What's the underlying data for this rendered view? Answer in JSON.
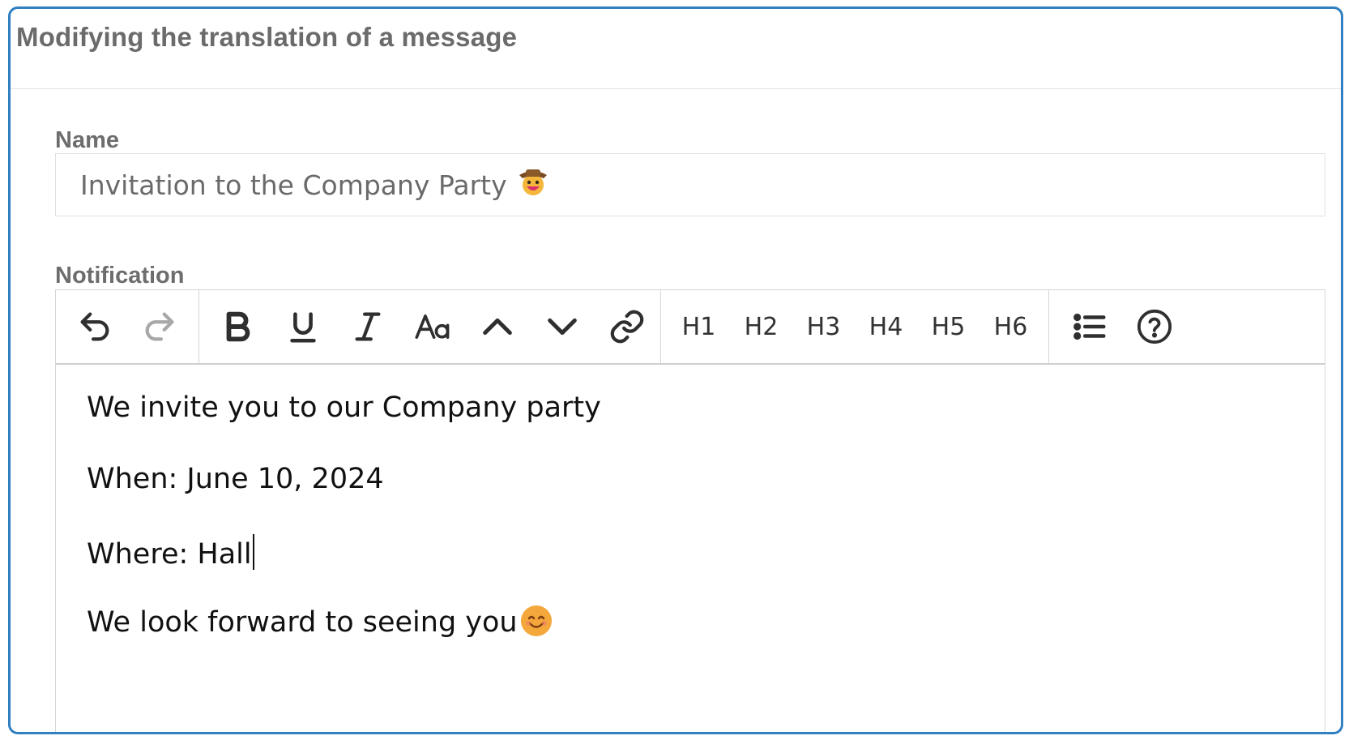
{
  "dialog": {
    "title": "Modifying the translation of a message"
  },
  "name_field": {
    "label": "Name",
    "value": "Invitation to the Company Party",
    "emoji": "🤠"
  },
  "notification": {
    "label": "Notification",
    "toolbar": {
      "history": [
        {
          "name": "undo-icon",
          "enabled": true
        },
        {
          "name": "redo-icon",
          "enabled": false
        }
      ],
      "format": [
        "bold-icon",
        "underline-icon",
        "italic-icon",
        "font-size-icon",
        "chevron-up-icon",
        "chevron-down-icon",
        "link-icon"
      ],
      "headings": [
        "H1",
        "H2",
        "H3",
        "H4",
        "H5",
        "H6"
      ],
      "extra": [
        "bullet-list-icon",
        "help-icon"
      ]
    },
    "lines": [
      "We invite you to our Company party",
      "When: June 10, 2024",
      "Where: Hall",
      "We look forward to seeing you"
    ],
    "last_line_emoji": "smiling-face"
  },
  "colors": {
    "border_accent": "#2f7fc1",
    "label": "#6d6d6d",
    "emoji": "#f4a73a"
  }
}
